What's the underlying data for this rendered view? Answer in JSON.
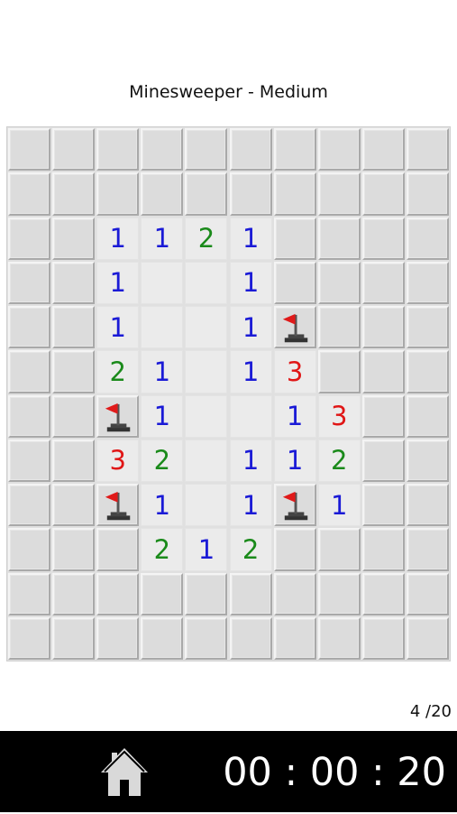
{
  "header": {
    "title": "Minesweeper - Medium"
  },
  "board": {
    "rows": 12,
    "cols": 10,
    "grid": [
      [
        "C",
        "C",
        "C",
        "C",
        "C",
        "C",
        "C",
        "C",
        "C",
        "C"
      ],
      [
        "C",
        "C",
        "C",
        "C",
        "C",
        "C",
        "C",
        "C",
        "C",
        "C"
      ],
      [
        "C",
        "C",
        "1",
        "1",
        "2",
        "1",
        "C",
        "C",
        "C",
        "C"
      ],
      [
        "C",
        "C",
        "1",
        "0",
        "0",
        "1",
        "C",
        "C",
        "C",
        "C"
      ],
      [
        "C",
        "C",
        "1",
        "0",
        "0",
        "1",
        "F",
        "C",
        "C",
        "C"
      ],
      [
        "C",
        "C",
        "2",
        "1",
        "0",
        "1",
        "3",
        "C",
        "C",
        "C"
      ],
      [
        "C",
        "C",
        "F",
        "1",
        "0",
        "0",
        "1",
        "3",
        "C",
        "C"
      ],
      [
        "C",
        "C",
        "3",
        "2",
        "0",
        "1",
        "1",
        "2",
        "C",
        "C"
      ],
      [
        "C",
        "C",
        "F",
        "1",
        "0",
        "1",
        "F",
        "1",
        "C",
        "C"
      ],
      [
        "C",
        "C",
        "C",
        "2",
        "1",
        "2",
        "C",
        "C",
        "C",
        "C"
      ],
      [
        "C",
        "C",
        "C",
        "C",
        "C",
        "C",
        "C",
        "C",
        "C",
        "C"
      ],
      [
        "C",
        "C",
        "C",
        "C",
        "C",
        "C",
        "C",
        "C",
        "C",
        "C"
      ]
    ],
    "number_colors": {
      "1": "#1a1ad6",
      "2": "#1a8a1a",
      "3": "#e01616"
    },
    "flag_color": "#e01a1a"
  },
  "status": {
    "counter": "4 /20"
  },
  "footer": {
    "home_icon": "home-icon",
    "timer": "00 : 00 : 20"
  }
}
